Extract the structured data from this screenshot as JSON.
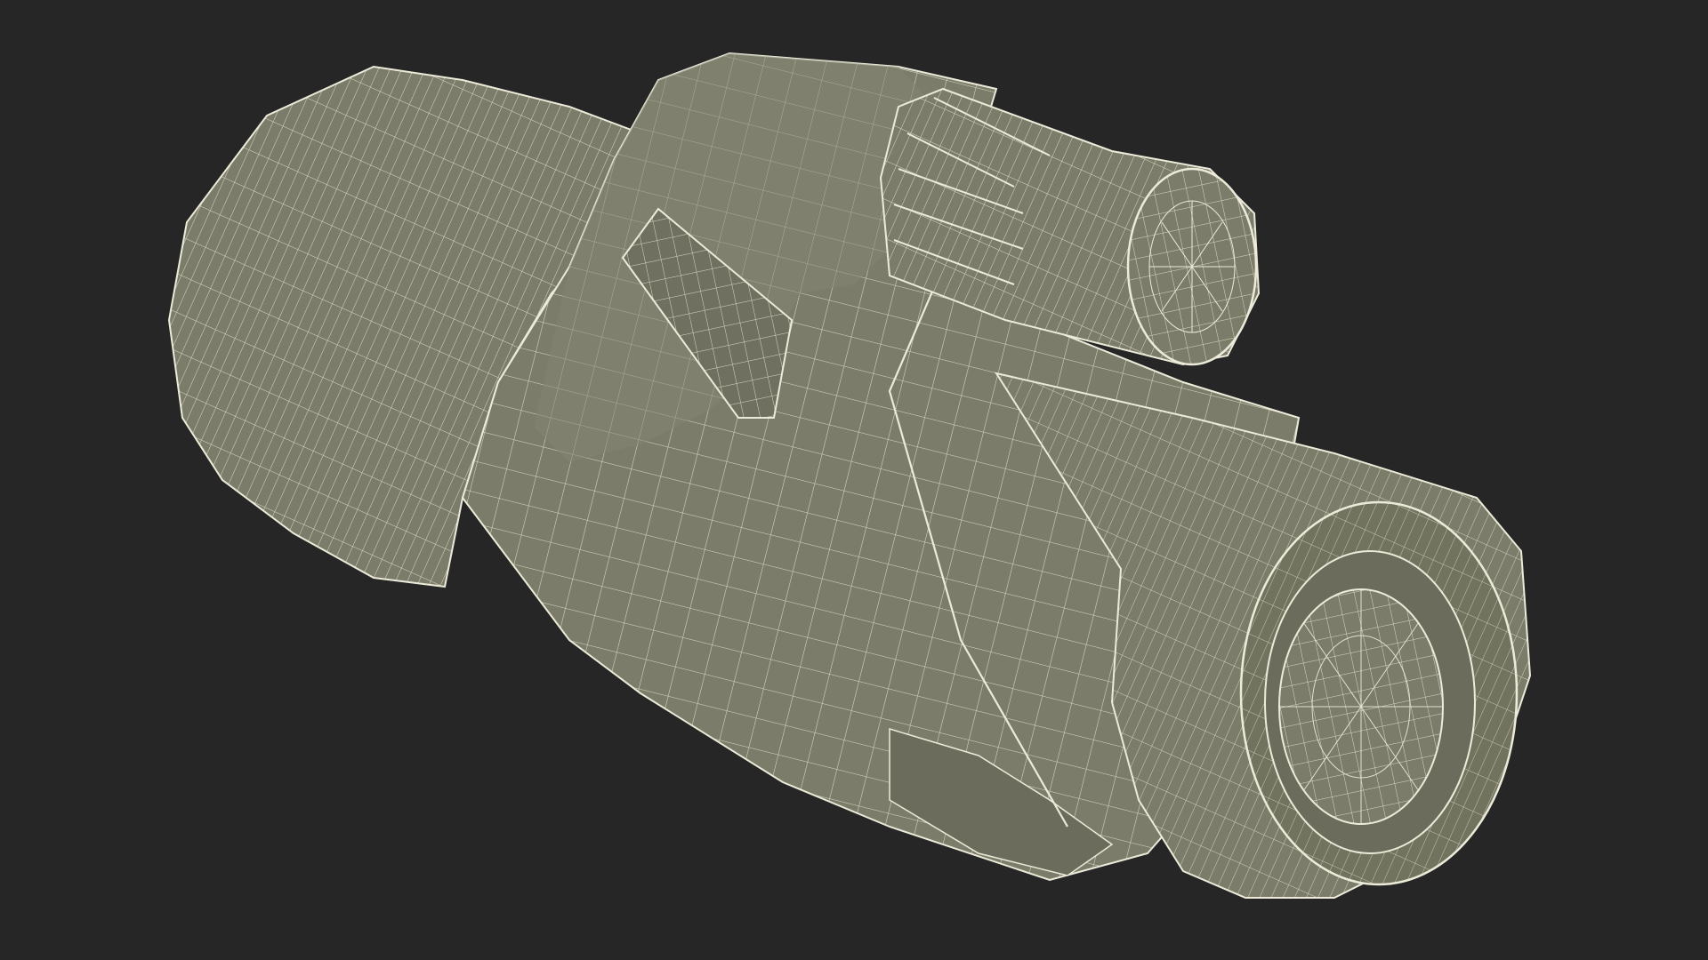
{
  "scene": {
    "subject": "monocular-wireframe-render",
    "colors": {
      "background": "#262626",
      "surface": "#7b7c69",
      "surface_dark": "#6b6c5b",
      "surface_light": "#8a8b77",
      "wire": "#ecebd9"
    }
  }
}
